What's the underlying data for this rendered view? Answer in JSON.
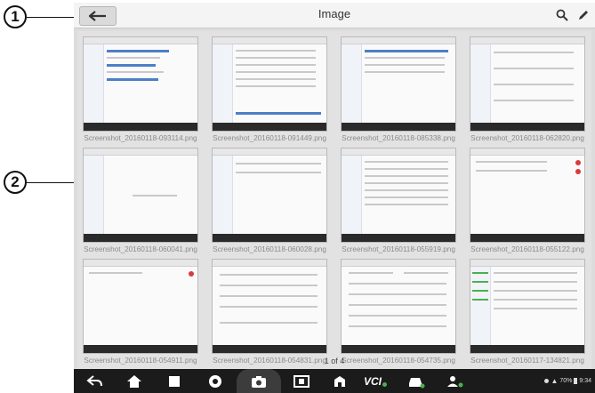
{
  "callouts": {
    "one": "1",
    "two": "2"
  },
  "header": {
    "title": "Image"
  },
  "icons": {
    "back": "back-arrow-icon",
    "search": "search-icon",
    "edit": "pencil-icon"
  },
  "gallery": {
    "items": [
      {
        "label": "Screenshot_20160118-093114.png"
      },
      {
        "label": "Screenshot_20160118-091449.png"
      },
      {
        "label": "Screenshot_20160118-085338.png"
      },
      {
        "label": "Screenshot_20160118-062820.png"
      },
      {
        "label": "Screenshot_20160118-060041.png"
      },
      {
        "label": "Screenshot_20160118-060028.png"
      },
      {
        "label": "Screenshot_20160118-055919.png"
      },
      {
        "label": "Screenshot_20160118-055122.png"
      },
      {
        "label": "Screenshot_20160118-054911.png"
      },
      {
        "label": "Screenshot_20160118-054831.png"
      },
      {
        "label": "Screenshot_20160118-054735.png"
      },
      {
        "label": "Screenshot_20160117-134821.png"
      }
    ],
    "pager": "1 of 4"
  },
  "navbar": {
    "items": [
      "back-icon",
      "home-icon",
      "recent-apps-icon",
      "browser-icon",
      "camera-icon",
      "screen-mirror-icon",
      "maxifix-icon",
      "vci-icon",
      "vehicle-icon",
      "user-icon"
    ],
    "vci_label": "VCI",
    "status_text": "70%",
    "time": "9:34"
  },
  "colors": {
    "navbar": "#1b1b1b",
    "accent": "#4c7fc6",
    "green": "#4caf50"
  }
}
